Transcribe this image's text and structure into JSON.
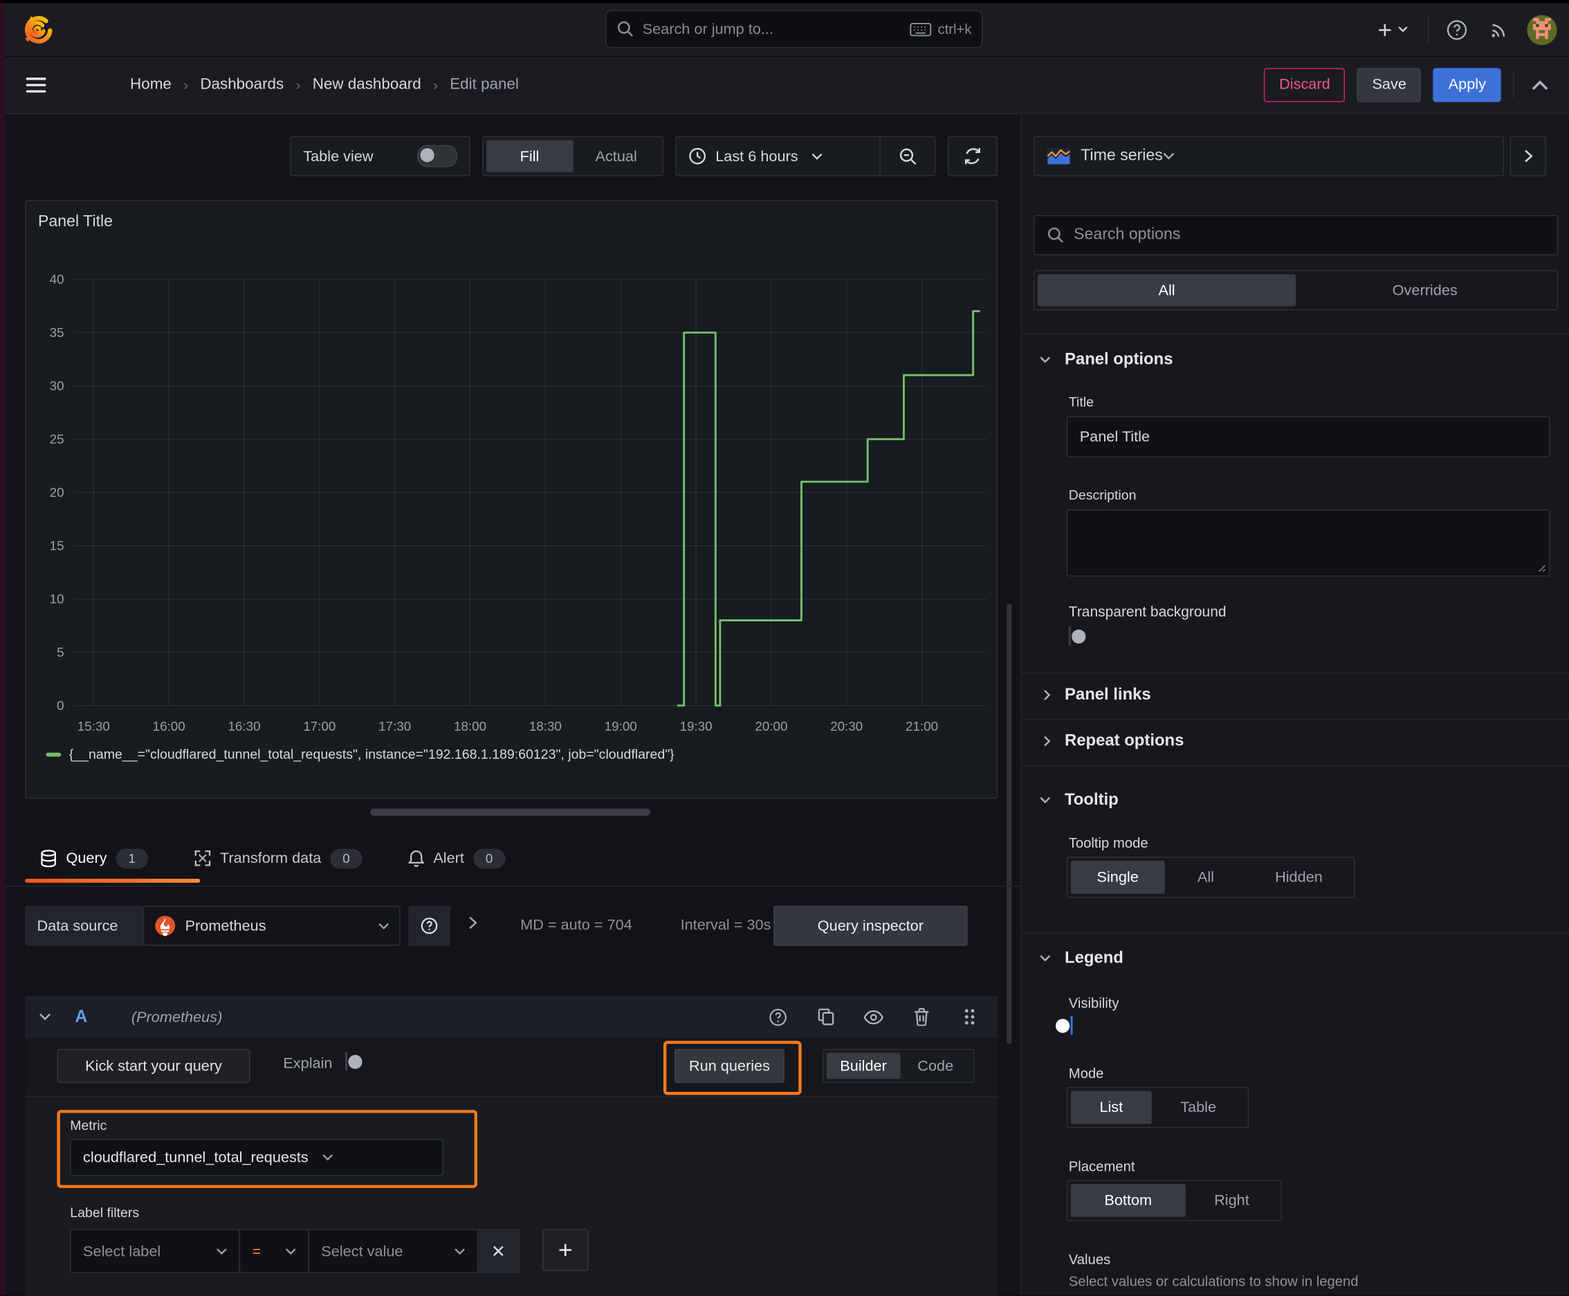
{
  "topnav": {
    "search_placeholder": "Search or jump to...",
    "search_shortcut": "ctrl+k"
  },
  "breadcrumb": {
    "items": [
      "Home",
      "Dashboards",
      "New dashboard",
      "Edit panel"
    ]
  },
  "actions": {
    "discard": "Discard",
    "save": "Save",
    "apply": "Apply"
  },
  "panel_toolbar": {
    "table_view": "Table view",
    "fill": "Fill",
    "actual": "Actual",
    "time_range": "Last 6 hours"
  },
  "panel": {
    "title": "Panel Title"
  },
  "chart_data": {
    "type": "line",
    "title": "Panel Title",
    "x_domain_hours": [
      15.37,
      21.43
    ],
    "ylim": [
      0,
      40
    ],
    "grid": true,
    "legend_position": "bottom",
    "y_ticks": [
      0,
      5,
      10,
      15,
      20,
      25,
      30,
      35,
      40
    ],
    "x_ticks": [
      {
        "t": 15.5,
        "label": "15:30"
      },
      {
        "t": 16.0,
        "label": "16:00"
      },
      {
        "t": 16.5,
        "label": "16:30"
      },
      {
        "t": 17.0,
        "label": "17:00"
      },
      {
        "t": 17.5,
        "label": "17:30"
      },
      {
        "t": 18.0,
        "label": "18:00"
      },
      {
        "t": 18.5,
        "label": "18:30"
      },
      {
        "t": 19.0,
        "label": "19:00"
      },
      {
        "t": 19.5,
        "label": "19:30"
      },
      {
        "t": 20.0,
        "label": "20:00"
      },
      {
        "t": 20.5,
        "label": "20:30"
      },
      {
        "t": 21.0,
        "label": "21:00"
      }
    ],
    "series": [
      {
        "name": "{__name__=\"cloudflared_tunnel_total_requests\", instance=\"192.168.1.189:60123\", job=\"cloudflared\"}",
        "color": "#73bf69",
        "points": [
          [
            19.38,
            0
          ],
          [
            19.42,
            0
          ],
          [
            19.42,
            35
          ],
          [
            19.63,
            35
          ],
          [
            19.63,
            0
          ],
          [
            19.66,
            0
          ],
          [
            19.66,
            8
          ],
          [
            20.2,
            8
          ],
          [
            20.2,
            21
          ],
          [
            20.64,
            21
          ],
          [
            20.64,
            25
          ],
          [
            20.88,
            25
          ],
          [
            20.88,
            31
          ],
          [
            21.34,
            31
          ],
          [
            21.34,
            37
          ],
          [
            21.38,
            37
          ]
        ]
      }
    ]
  },
  "query_tabs": [
    {
      "label": "Query",
      "count": "1"
    },
    {
      "label": "Transform data",
      "count": "0"
    },
    {
      "label": "Alert",
      "count": "0"
    }
  ],
  "datasource_row": {
    "label": "Data source",
    "name": "Prometheus",
    "stats": "MD = auto = 704",
    "interval": "Interval = 30s",
    "inspector": "Query inspector"
  },
  "query": {
    "ref": "A",
    "datasource_hint": "(Prometheus)",
    "kickstart": "Kick start your query",
    "explain": "Explain",
    "run": "Run queries",
    "builder": "Builder",
    "code": "Code",
    "metric_label": "Metric",
    "metric_value": "cloudflared_tunnel_total_requests",
    "label_filters": "Label filters",
    "select_label": "Select label",
    "operator": "=",
    "select_value": "Select value"
  },
  "sidebar": {
    "visualization": "Time series",
    "search_placeholder": "Search options",
    "filter_tabs": {
      "all": "All",
      "overrides": "Overrides"
    },
    "panel_options": {
      "header": "Panel options",
      "title_label": "Title",
      "title_value": "Panel Title",
      "description_label": "Description",
      "transparent_label": "Transparent background"
    },
    "panel_links": "Panel links",
    "repeat_options": "Repeat options",
    "tooltip": {
      "header": "Tooltip",
      "mode_label": "Tooltip mode",
      "single": "Single",
      "all": "All",
      "hidden": "Hidden"
    },
    "legend": {
      "header": "Legend",
      "visibility_label": "Visibility",
      "mode_label": "Mode",
      "list": "List",
      "table": "Table",
      "placement_label": "Placement",
      "bottom": "Bottom",
      "right": "Right",
      "values_label": "Values",
      "values_help": "Select values or calculations to show in legend"
    }
  },
  "colors": {
    "accent_orange": "#ff7a1a",
    "brand_orange": "#f2551b",
    "primary_blue": "#3d71d9",
    "danger_pink": "#e0226e",
    "series_green": "#73bf69"
  }
}
